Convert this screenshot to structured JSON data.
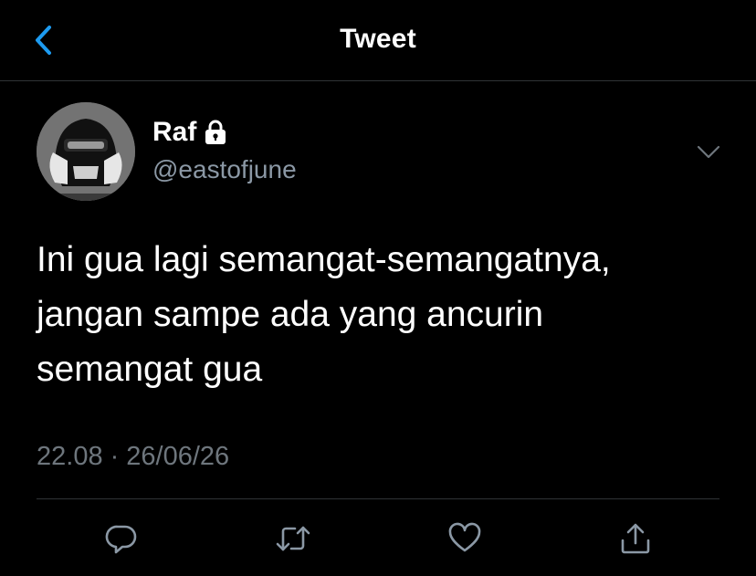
{
  "header": {
    "title": "Tweet",
    "back_icon": "chevron-left-icon"
  },
  "tweet": {
    "author": {
      "display_name": "Raf",
      "handle": "@eastofjune",
      "protected_icon": "lock-icon"
    },
    "text_lines": [
      "Ini gua lagi semangat-semangatnya,",
      "jangan sampe ada yang ancurin",
      "semangat gua"
    ],
    "time": "22.08",
    "separator": "·",
    "date": "26/06/26"
  },
  "actions": [
    {
      "name": "reply",
      "icon": "reply-icon"
    },
    {
      "name": "retweet",
      "icon": "retweet-icon"
    },
    {
      "name": "like",
      "icon": "heart-icon"
    },
    {
      "name": "share",
      "icon": "share-icon"
    }
  ],
  "colors": {
    "background": "#000000",
    "accent": "#1d9bf0",
    "secondary_text": "#8b98a5",
    "meta_text": "#6e767d",
    "divider": "#2f3336"
  }
}
